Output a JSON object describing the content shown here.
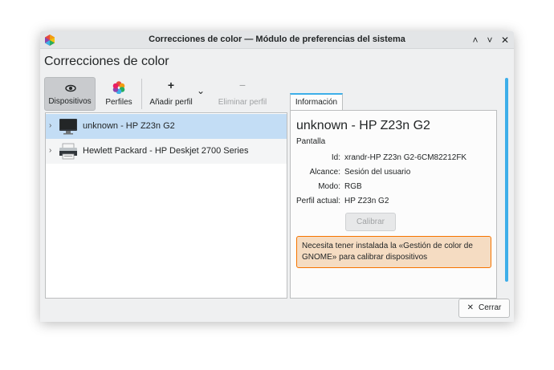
{
  "window": {
    "title": "Correcciones de color — Módulo de preferencias del sistema",
    "controls": [
      "˄",
      "˅",
      "✕"
    ]
  },
  "heading": "Correcciones de color",
  "toolbar": {
    "dispositivos": "Dispositivos",
    "perfiles": "Perfiles",
    "anadir": "Añadir perfil",
    "eliminar": "Eliminar perfil",
    "add_glyph": "+",
    "remove_glyph": "−",
    "dropdown_glyph": "⌄"
  },
  "devices": [
    {
      "label": "unknown - HP Z23n G2",
      "icon": "monitor-icon",
      "selected": true
    },
    {
      "label": "Hewlett Packard - HP Deskjet 2700 Series",
      "icon": "printer-icon",
      "selected": false
    }
  ],
  "expander": "›",
  "tab": "Información",
  "info": {
    "title": "unknown - HP Z23n G2",
    "type": "Pantalla",
    "fields": [
      {
        "key": "Id:",
        "value": "xrandr-HP Z23n G2-6CM82212FK"
      },
      {
        "key": "Alcance:",
        "value": "Sesión del usuario"
      },
      {
        "key": "Modo:",
        "value": "RGB"
      },
      {
        "key": "Perfil actual:",
        "value": "HP Z23n G2"
      }
    ],
    "calibrar": "Calibrar",
    "warning": "Necesita tener instalada la «Gestión de color de GNOME» para calibrar dispositivos"
  },
  "footer": {
    "close_glyph": "✕",
    "close_label": "Cerrar"
  },
  "colors": {
    "accent": "#3daee9",
    "selection": "#c3ddf5",
    "warning_border": "#f67400",
    "warning_bg": "#f5dcc2"
  }
}
